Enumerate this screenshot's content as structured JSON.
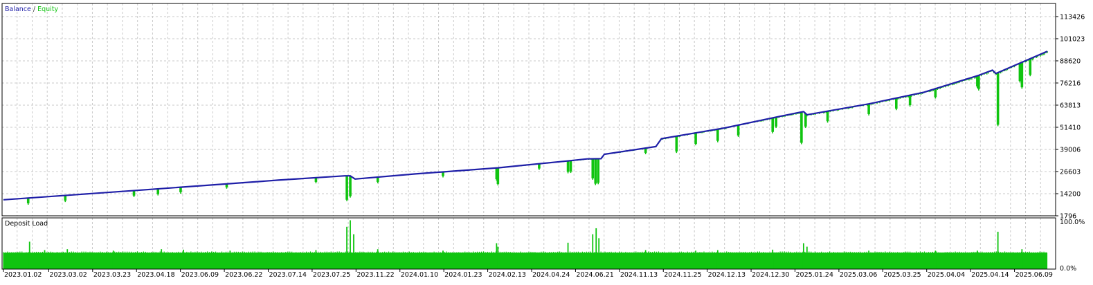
{
  "colors": {
    "balance": "#1f1fa8",
    "equity": "#10c410",
    "grid": "#c9c9c9",
    "frame": "#000000",
    "balance_label": "#1f1fa8",
    "equity_label": "#10c410"
  },
  "legend": {
    "balance": "Balance",
    "separator": " / ",
    "equity": "Equity"
  },
  "chart_data": [
    {
      "type": "line",
      "title": "",
      "legend_placement": "top-left",
      "series": [
        {
          "name": "Balance",
          "color": "#1f1fa8"
        },
        {
          "name": "Equity",
          "color": "#10c410"
        }
      ],
      "ylim": [
        1796,
        120000
      ],
      "y_ticks": [
        113426,
        101023,
        88620,
        76216,
        63813,
        51410,
        39006,
        26603,
        14200,
        1796
      ],
      "y_tick_labels": [
        "113426",
        "101023",
        "88620",
        "76216",
        "63813",
        "51410",
        "39006",
        "26603",
        "14200",
        "1796"
      ],
      "grid": true,
      "balance_points": [
        [
          0,
          10800
        ],
        [
          100,
          13500
        ],
        [
          200,
          16200
        ],
        [
          300,
          19000
        ],
        [
          400,
          21800
        ],
        [
          497,
          24200
        ],
        [
          505,
          24200
        ],
        [
          512,
          22400
        ],
        [
          600,
          25300
        ],
        [
          720,
          28700
        ],
        [
          820,
          32500
        ],
        [
          850,
          33700
        ],
        [
          870,
          33800
        ],
        [
          875,
          36300
        ],
        [
          950,
          40600
        ],
        [
          958,
          45000
        ],
        [
          1050,
          51000
        ],
        [
          1130,
          57500
        ],
        [
          1165,
          60200
        ],
        [
          1170,
          58400
        ],
        [
          1260,
          64500
        ],
        [
          1340,
          71000
        ],
        [
          1420,
          80500
        ],
        [
          1440,
          83400
        ],
        [
          1445,
          81500
        ],
        [
          1520,
          94000
        ]
      ],
      "equity_drawdowns": [
        [
          36,
          8000
        ],
        [
          90,
          9500
        ],
        [
          190,
          12300
        ],
        [
          225,
          13200
        ],
        [
          258,
          14200
        ],
        [
          325,
          17000
        ],
        [
          455,
          20000
        ],
        [
          500,
          10000
        ],
        [
          505,
          12000
        ],
        [
          545,
          20000
        ],
        [
          640,
          23300
        ],
        [
          718,
          21500
        ],
        [
          720,
          18800
        ],
        [
          780,
          27500
        ],
        [
          822,
          25600
        ],
        [
          826,
          25800
        ],
        [
          858,
          22000
        ],
        [
          862,
          19000
        ],
        [
          866,
          19500
        ],
        [
          935,
          36300
        ],
        [
          980,
          37000
        ],
        [
          1008,
          41300
        ],
        [
          1040,
          43000
        ],
        [
          1070,
          46000
        ],
        [
          1120,
          48000
        ],
        [
          1125,
          51000
        ],
        [
          1162,
          41900
        ],
        [
          1168,
          51000
        ],
        [
          1200,
          54000
        ],
        [
          1260,
          58000
        ],
        [
          1300,
          61000
        ],
        [
          1320,
          63000
        ],
        [
          1357,
          67500
        ],
        [
          1418,
          73500
        ],
        [
          1420,
          72000
        ],
        [
          1448,
          52000
        ],
        [
          1480,
          76500
        ],
        [
          1483,
          73000
        ],
        [
          1495,
          80000
        ]
      ]
    },
    {
      "type": "area",
      "title": "Deposit Load",
      "ylim": [
        0,
        100
      ],
      "y_tick_labels": [
        "100.0%",
        "0.0%"
      ],
      "grid": true,
      "baseline_load": 0.33,
      "spikes": [
        [
          38,
          0.55
        ],
        [
          60,
          0.38
        ],
        [
          93,
          0.4
        ],
        [
          160,
          0.37
        ],
        [
          230,
          0.4
        ],
        [
          262,
          0.39
        ],
        [
          330,
          0.37
        ],
        [
          455,
          0.38
        ],
        [
          500,
          0.85
        ],
        [
          505,
          0.98
        ],
        [
          510,
          0.7
        ],
        [
          545,
          0.4
        ],
        [
          640,
          0.37
        ],
        [
          718,
          0.52
        ],
        [
          720,
          0.45
        ],
        [
          822,
          0.53
        ],
        [
          858,
          0.7
        ],
        [
          863,
          0.82
        ],
        [
          867,
          0.62
        ],
        [
          935,
          0.38
        ],
        [
          1008,
          0.37
        ],
        [
          1040,
          0.38
        ],
        [
          1120,
          0.39
        ],
        [
          1165,
          0.52
        ],
        [
          1170,
          0.45
        ],
        [
          1260,
          0.37
        ],
        [
          1357,
          0.37
        ],
        [
          1418,
          0.37
        ],
        [
          1448,
          0.75
        ],
        [
          1483,
          0.4
        ]
      ],
      "x_ticks": [
        "2023.01.02",
        "2023.03.02",
        "2023.03.23",
        "2023.04.18",
        "2023.06.09",
        "2023.06.22",
        "2023.07.14",
        "2023.07.25",
        "2023.11.22",
        "2024.01.10",
        "2024.01.23",
        "2024.02.13",
        "2024.04.24",
        "2024.06.21",
        "2024.11.13",
        "2024.11.25",
        "2024.12.13",
        "2024.12.30",
        "2025.01.24",
        "2025.03.06",
        "2025.03.25",
        "2025.04.04",
        "2025.04.14",
        "2025.06.09"
      ]
    }
  ]
}
